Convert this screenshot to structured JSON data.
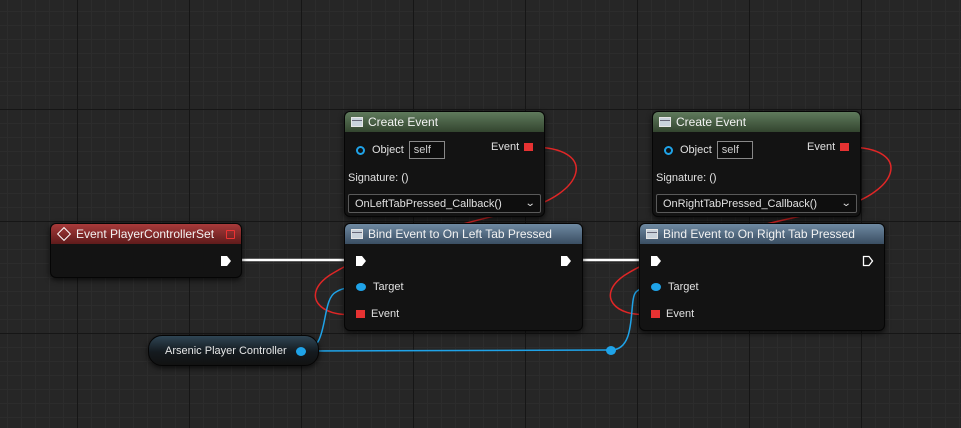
{
  "colors": {
    "object_pin": "#1fa3e8",
    "delegate_pin": "#e63232",
    "exec_wire": "#ffffff"
  },
  "event_node": {
    "title": "Event PlayerControllerSet",
    "icon": "event-diamond-icon"
  },
  "create_event_left": {
    "title": "Create Event",
    "object_label": "Object",
    "object_value": "self",
    "event_label": "Event",
    "signature": "Signature: ()",
    "function": "OnLeftTabPressed_Callback()"
  },
  "create_event_right": {
    "title": "Create Event",
    "object_label": "Object",
    "object_value": "self",
    "event_label": "Event",
    "signature": "Signature: ()",
    "function": "OnRightTabPressed_Callback()"
  },
  "bind_left": {
    "title": "Bind Event to On Left Tab Pressed",
    "target_label": "Target",
    "event_label": "Event"
  },
  "bind_right": {
    "title": "Bind Event to On Right Tab Pressed",
    "target_label": "Target",
    "event_label": "Event"
  },
  "variable_node": {
    "label": "Arsenic Player Controller"
  }
}
